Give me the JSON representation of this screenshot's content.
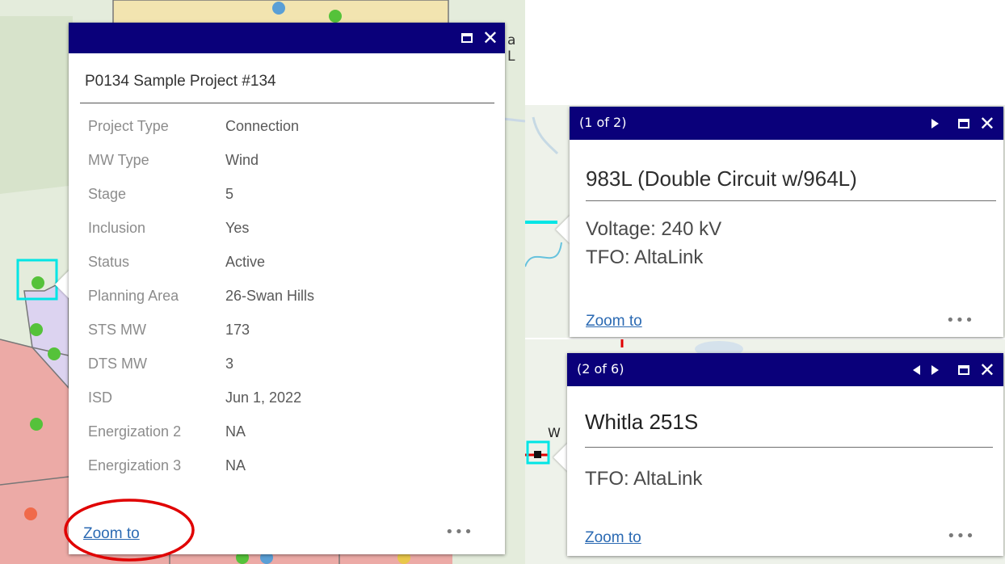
{
  "popup_main": {
    "title": "P0134 Sample Project #134",
    "attributes": [
      {
        "label": "Project Type",
        "value": "Connection"
      },
      {
        "label": "MW Type",
        "value": "Wind"
      },
      {
        "label": "Stage",
        "value": "5"
      },
      {
        "label": "Inclusion",
        "value": "Yes"
      },
      {
        "label": "Status",
        "value": "Active"
      },
      {
        "label": "Planning Area",
        "value": "26-Swan Hills"
      },
      {
        "label": "STS MW",
        "value": "173"
      },
      {
        "label": "DTS MW",
        "value": "3"
      },
      {
        "label": "ISD",
        "value": "Jun 1, 2022"
      },
      {
        "label": "Energization 2",
        "value": "NA"
      },
      {
        "label": "Energization 3",
        "value": "NA"
      }
    ],
    "zoom_label": "Zoom to",
    "more_label": "•••"
  },
  "popup_line": {
    "count": "(1 of 2)",
    "title": "983L (Double Circuit w/964L)",
    "lines": [
      "Voltage: 240 kV",
      "TFO: AltaLink"
    ],
    "zoom_label": "Zoom to",
    "more_label": "•••"
  },
  "popup_sub": {
    "count": "(2 of 6)",
    "title": "Whitla 251S",
    "lines": [
      "TFO: AltaLink"
    ],
    "zoom_label": "Zoom to",
    "more_label": "•••"
  },
  "map": {
    "partial_label_main": "a L",
    "partial_label_sub": "W"
  },
  "colors": {
    "header_bg": "#0a007a",
    "highlight": "#00e5e5",
    "annotation_red": "#e00000",
    "map_green": "#e4ecdc",
    "map_red_zone": "#ecaaa6",
    "map_yellow_zone": "#f2e4b0",
    "point_green": "#55c23a"
  },
  "icons": [
    "maximize-icon",
    "close-icon",
    "next-icon",
    "previous-icon",
    "more-icon"
  ]
}
